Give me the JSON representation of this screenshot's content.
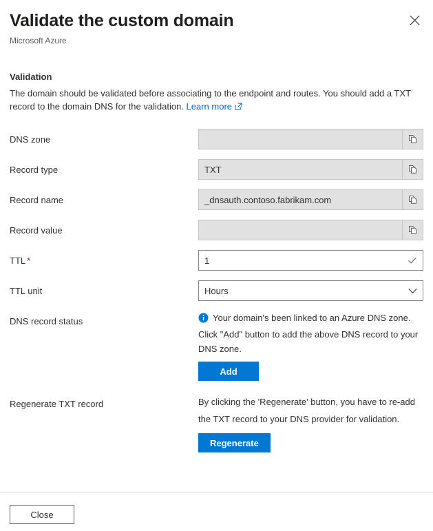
{
  "header": {
    "title": "Validate the custom domain",
    "subtitle": "Microsoft Azure",
    "close_icon": "close-icon"
  },
  "validation": {
    "section_title": "Validation",
    "description_part1": "The domain should be validated before associating to the endpoint and routes. You should add a TXT record to the domain DNS for the validation. ",
    "learn_more_label": "Learn more",
    "external_link_icon": "external-link-icon"
  },
  "fields": {
    "dns_zone": {
      "label": "DNS zone",
      "value": "",
      "copy_icon": "copy-icon"
    },
    "record_type": {
      "label": "Record type",
      "value": "TXT",
      "copy_icon": "copy-icon"
    },
    "record_name": {
      "label": "Record name",
      "value": "_dnsauth.contoso.fabrikam.com",
      "copy_icon": "copy-icon"
    },
    "record_value": {
      "label": "Record value",
      "value": "",
      "copy_icon": "copy-icon"
    },
    "ttl": {
      "label": "TTL",
      "required_marker": "*",
      "value": "1",
      "placeholder": "",
      "valid_icon": "checkmark-icon"
    },
    "ttl_unit": {
      "label": "TTL unit",
      "selected": "Hours",
      "options": [
        "Hours"
      ],
      "chevron_icon": "chevron-down-icon"
    }
  },
  "dns_record_status": {
    "label": "DNS record status",
    "info_icon": "info-icon",
    "message": "Your domain's been linked to an Azure DNS zone. Click \"Add\" button to add the above DNS record to your DNS zone.",
    "add_button_label": "Add"
  },
  "regenerate": {
    "label": "Regenerate TXT record",
    "message": "By clicking the 'Regenerate' button, you have to re-add the TXT record to your DNS provider for validation.",
    "button_label": "Regenerate"
  },
  "footer": {
    "close_label": "Close"
  },
  "colors": {
    "accent": "#0078d4",
    "link": "#0066cc",
    "required": "#a4262c",
    "text": "#323130",
    "subtle_text": "#605e5c",
    "field_disabled_bg": "#e1e1e1",
    "field_border": "#8a8886",
    "divider": "#e1dfdd"
  }
}
